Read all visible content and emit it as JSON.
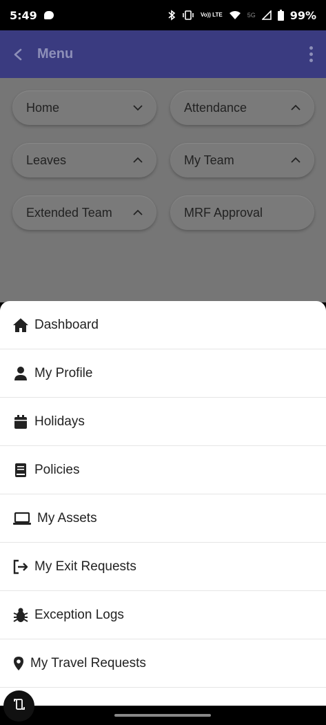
{
  "status_bar": {
    "time": "5:49",
    "network_label": "Vo)) LTE",
    "network_5g": "5G",
    "battery": "99%"
  },
  "app_bar": {
    "title": "Menu",
    "color": "#3a3b80"
  },
  "menu_pills": [
    {
      "label": "Home",
      "chevron": "down"
    },
    {
      "label": "Attendance",
      "chevron": "up"
    },
    {
      "label": "Leaves",
      "chevron": "up"
    },
    {
      "label": "My Team",
      "chevron": "up"
    },
    {
      "label": "Extended Team",
      "chevron": "up"
    },
    {
      "label": "MRF Approval",
      "chevron": "none"
    }
  ],
  "sheet_items": [
    {
      "label": "Dashboard",
      "icon": "home-icon"
    },
    {
      "label": "My Profile",
      "icon": "person-icon"
    },
    {
      "label": "Holidays",
      "icon": "calendar-icon"
    },
    {
      "label": "Policies",
      "icon": "book-icon"
    },
    {
      "label": "My Assets",
      "icon": "laptop-icon"
    },
    {
      "label": "My Exit Requests",
      "icon": "exit-icon"
    },
    {
      "label": "Exception Logs",
      "icon": "bug-icon"
    },
    {
      "label": "My Travel Requests",
      "icon": "location-pin-icon"
    }
  ]
}
